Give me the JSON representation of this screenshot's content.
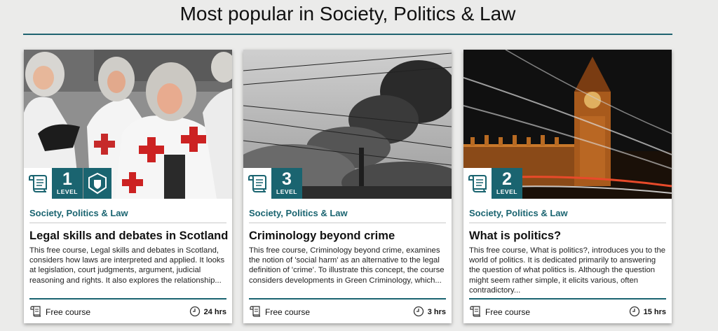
{
  "page": {
    "heading": "Most popular in Society, Politics & Law"
  },
  "cards": [
    {
      "image": "judges-in-robes-photo",
      "level_number": "1",
      "level_label": "LEVEL",
      "has_shield": true,
      "category": "Society, Politics & Law",
      "title": "Legal skills and debates in Scotland",
      "description": "This free course, Legal skills and debates in Scotland, considers how laws are interpreted and applied. It looks at legislation, court judgments, argument, judicial reasoning and rights. It also explores the relationship...",
      "type": "Free course",
      "duration": "24 hrs"
    },
    {
      "image": "industrial-smoke-photo",
      "level_number": "3",
      "level_label": "LEVEL",
      "has_shield": false,
      "category": "Society, Politics & Law",
      "title": "Criminology beyond crime",
      "description": "This free course, Criminology beyond crime, examines the notion of 'social harm' as an alternative to the legal definition of 'crime'. To illustrate this concept, the course considers developments in Green Criminology, which...",
      "type": "Free course",
      "duration": "3 hrs"
    },
    {
      "image": "big-ben-night-photo",
      "level_number": "2",
      "level_label": "LEVEL",
      "has_shield": false,
      "category": "Society, Politics & Law",
      "title": "What is politics?",
      "description": "This free course, What is politics?, introduces you to the world of politics. It is dedicated primarily to answering the question of what politics is. Although the question might seem rather simple, it elicits various, often contradictory...",
      "type": "Free course",
      "duration": "15 hrs"
    }
  ]
}
